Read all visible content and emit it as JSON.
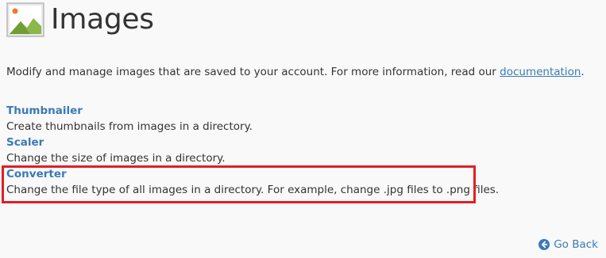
{
  "header": {
    "title": "Images",
    "icon": "images-icon"
  },
  "intro": {
    "text": "Modify and manage images that are saved to your account. For more information, read our ",
    "link_label": "documentation",
    "suffix": "."
  },
  "tools": [
    {
      "label": "Thumbnailer",
      "description": "Create thumbnails from images in a directory."
    },
    {
      "label": "Scaler",
      "description": "Change the size of images in a directory."
    },
    {
      "label": "Converter",
      "description": "Change the file type of all images in a directory. For example, change .jpg files to .png files."
    }
  ],
  "footer": {
    "go_back_label": "Go Back",
    "go_back_icon": "arrow-left-circle-icon"
  },
  "colors": {
    "link": "#3a7ab8",
    "text": "#333333",
    "highlight_border": "#e01f26",
    "background": "#f9f9f9"
  }
}
